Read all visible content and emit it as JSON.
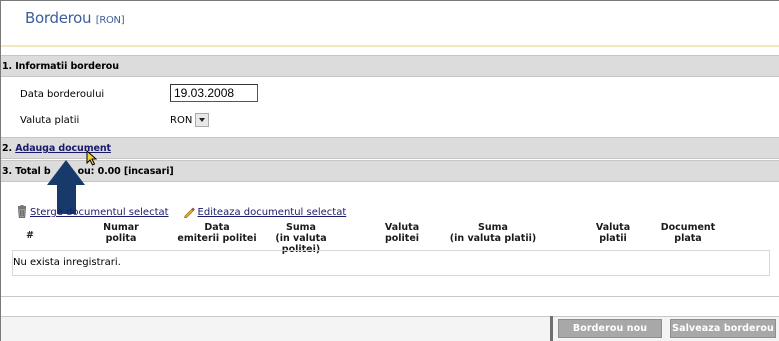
{
  "header": {
    "title": "Borderou",
    "currency_tag": "[RON]"
  },
  "sections": {
    "info_title": "1. Informatii borderou",
    "add_prefix": "2.",
    "add_link": "Adauga document",
    "total_prefix": "3. Total b",
    "total_suffix": "ou: 0.00 [incasari]"
  },
  "form": {
    "date_label": "Data borderoului",
    "date_value": "19.03.2008",
    "currency_label": "Valuta platii",
    "currency_value": "RON"
  },
  "actions": {
    "delete_label": "Sterge documentul selectat",
    "edit_label": "Editeaza documentul selectat"
  },
  "table": {
    "columns": {
      "num": "#",
      "policy_number": [
        "Numar",
        "polita"
      ],
      "issue_date": [
        "Data",
        "emiterii politei"
      ],
      "sum_policy": [
        "Suma",
        "(in valuta politei)"
      ],
      "policy_currency": [
        "Valuta",
        "politei"
      ],
      "sum_payment": [
        "Suma",
        "(in valuta platii)"
      ],
      "payment_currency": [
        "Valuta",
        "platii"
      ],
      "payment_doc": [
        "Document",
        "plata"
      ]
    },
    "empty_message": "Nu exista inregistrari."
  },
  "buttons": {
    "new": "Borderou nou",
    "save": "Salveaza borderou"
  },
  "colors": {
    "title": "#3c5f99",
    "section_bg": "#dcdcdc",
    "arrow": "#173a6b",
    "button_bg": "#a8a8a8",
    "link": "#1a1a6c"
  },
  "icons": [
    "trash-icon",
    "pencil-icon",
    "arrow-up-icon",
    "mouse-cursor-icon",
    "dropdown-arrow-icon"
  ]
}
